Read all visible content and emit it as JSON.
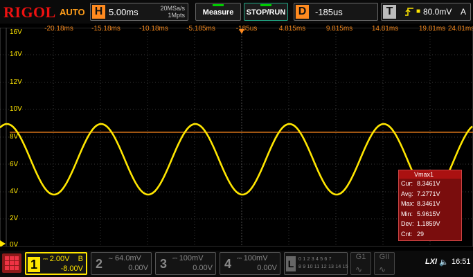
{
  "brand": "RIGOL",
  "acquire_mode": "AUTO",
  "horizontal": {
    "letter": "H",
    "timebase": "5.00ms",
    "sample_rate": "20MSa/s",
    "memory_depth": "1Mpts"
  },
  "buttons": {
    "measure": "Measure",
    "stop_run": "STOP/RUN"
  },
  "delay": {
    "letter": "D",
    "value": "-185us"
  },
  "trigger": {
    "letter": "T",
    "level": "80.0mV",
    "source": "A"
  },
  "time_axis_labels": [
    "-20.18ms",
    "-15.18ms",
    "-10.18ms",
    "-5.185ms",
    "-185us",
    "4.815ms",
    "9.815ms",
    "14.81ms",
    "19.81ms",
    "24.81ms"
  ],
  "voltage_labels": [
    "16V",
    "14V",
    "12V",
    "10V",
    "8V",
    "6V",
    "4V",
    "2V",
    "0V"
  ],
  "measurement": {
    "title": "Vmax1",
    "rows": [
      {
        "k": "Cur:",
        "v": "8.3461V"
      },
      {
        "k": "Avg:",
        "v": "7.2771V"
      },
      {
        "k": "Max:",
        "v": "8.3461V"
      },
      {
        "k": "Min:",
        "v": "5.9615V"
      },
      {
        "k": "Dev:",
        "v": "1.1859V"
      },
      {
        "k": "Cnt:",
        "v": "29"
      }
    ]
  },
  "channels": [
    {
      "num": "1",
      "scale": "2.00V",
      "offset": "-8.00V",
      "bw": "B"
    },
    {
      "num": "2",
      "scale": "64.0mV",
      "offset": "0.00V"
    },
    {
      "num": "3",
      "scale": "100mV",
      "offset": "0.00V"
    },
    {
      "num": "4",
      "scale": "100mV",
      "offset": "0.00V"
    }
  ],
  "la": {
    "letter": "L",
    "row1": "0 1 2 3 4 5 6 7",
    "row2": "8 9 10 11 12 13 14 15"
  },
  "gens": {
    "g1": "G1",
    "g2": "GII"
  },
  "time": "16:51",
  "lxi": "LXI",
  "colors": {
    "ch1": "#ffe600",
    "accent": "#ff8a1f",
    "trigger_line": "#ff8a1f",
    "meas_bg": "#7a0d0d"
  }
}
